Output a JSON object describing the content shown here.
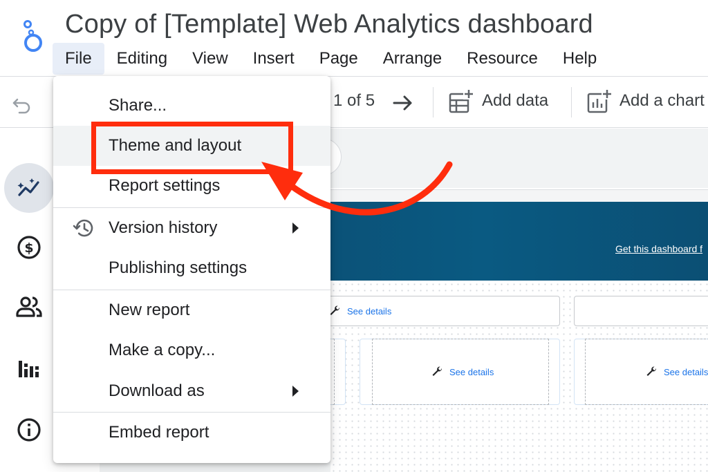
{
  "app": {
    "document_title": "Copy of [Template] Web Analytics dashboard"
  },
  "menubar": {
    "items": [
      {
        "label": "File"
      },
      {
        "label": "Editing"
      },
      {
        "label": "View"
      },
      {
        "label": "Insert"
      },
      {
        "label": "Page"
      },
      {
        "label": "Arrange"
      },
      {
        "label": "Resource"
      },
      {
        "label": "Help"
      }
    ],
    "active": "File"
  },
  "toolbar": {
    "page_indicator": "1 of 5",
    "add_data_label": "Add data",
    "add_chart_label": "Add a chart"
  },
  "rail": {
    "icons": [
      "analytics-icon",
      "dollar-icon",
      "people-icon",
      "bar-chart-icon",
      "info-icon"
    ],
    "active": "analytics-icon"
  },
  "file_menu": {
    "items": [
      {
        "label": "Share..."
      },
      {
        "label": "Theme and layout",
        "highlighted": true
      },
      {
        "label": "Report settings"
      },
      {
        "label": "Version history",
        "icon": "history-icon",
        "submenu": true
      },
      {
        "label": "Publishing settings"
      },
      {
        "label": "New report"
      },
      {
        "label": "Make a copy..."
      },
      {
        "label": "Download as",
        "submenu": true
      },
      {
        "label": "Embed report"
      }
    ]
  },
  "report": {
    "header_link": "Get this dashboard f",
    "see_details_label": "See details",
    "see_details_label_truncated": "See details",
    "header_color": "#0b5278"
  },
  "colors": {
    "annotation": "#ff2d0d",
    "link": "#1a73e8",
    "menu_active_bg": "#e8eef8"
  }
}
